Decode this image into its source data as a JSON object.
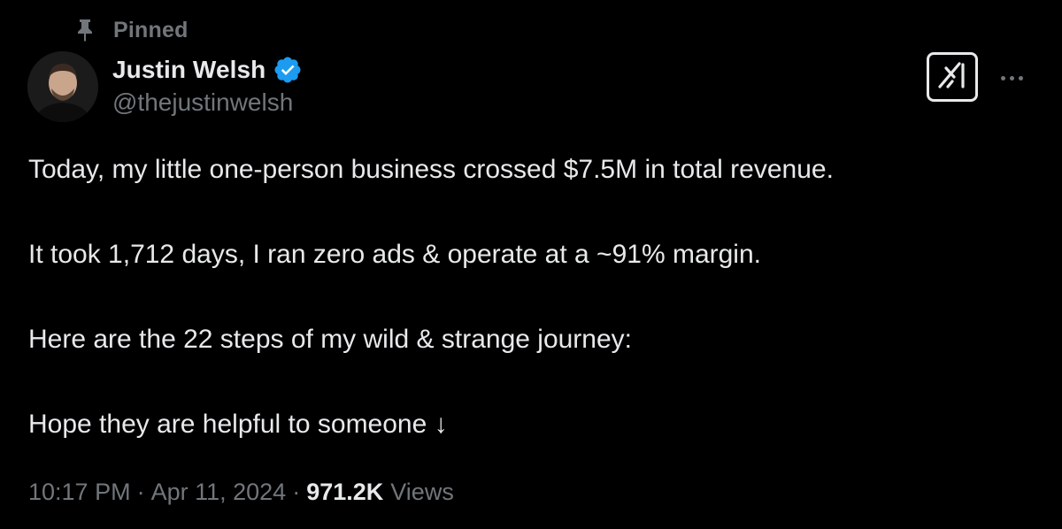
{
  "pinned": {
    "label": "Pinned",
    "icon": "pin-icon"
  },
  "author": {
    "display_name": "Justin Welsh",
    "handle": "@thejustinwelsh",
    "verified_icon": "verified-badge-icon",
    "verified_color": "#1d9bf0"
  },
  "actions": {
    "grok_icon": "grok-icon",
    "more_icon": "more-horizontal-icon"
  },
  "tweet": {
    "lines": [
      "Today, my little one-person business crossed $7.5M in total revenue.",
      "It took 1,712 days, I ran zero ads & operate at a ~91% margin.",
      "Here are the 22 steps of my wild & strange journey:",
      "Hope they are helpful to someone ↓"
    ]
  },
  "meta": {
    "time": "10:17 PM",
    "separator": "·",
    "date": "Apr 11, 2024",
    "views_count": "971.2K",
    "views_label": "Views"
  },
  "colors": {
    "background": "#000000",
    "primary_text": "#e7e9ea",
    "secondary_text": "#71767b"
  }
}
